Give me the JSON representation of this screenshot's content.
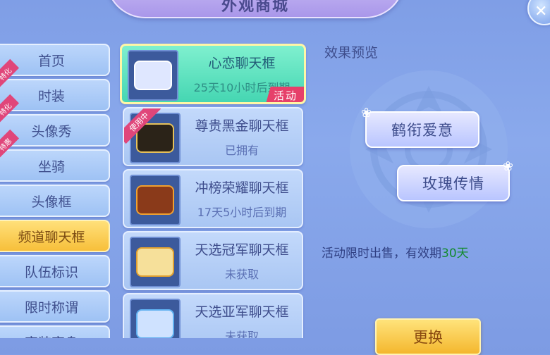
{
  "header": {
    "title": "外观商城"
  },
  "sidebar": {
    "items": [
      {
        "label": "首页"
      },
      {
        "label": "时装",
        "ribbon": "特化"
      },
      {
        "label": "头像秀",
        "ribbon": "特化"
      },
      {
        "label": "坐骑",
        "ribbon": "特惠"
      },
      {
        "label": "头像框"
      },
      {
        "label": "频道聊天框",
        "active": true
      },
      {
        "label": "队伍标识"
      },
      {
        "label": "限时称谓"
      },
      {
        "label": "变装变身"
      }
    ]
  },
  "items": [
    {
      "name": "心恋聊天框",
      "status": "25天10小时后到期",
      "badge": "活动",
      "bubble_color": "#dfe7ff",
      "selected": true
    },
    {
      "name": "尊贵黑金聊天框",
      "status": "已拥有",
      "badge": "使用中",
      "bubble_color": "#2b2318"
    },
    {
      "name": "冲榜荣耀聊天框",
      "status": "17天5小时后到期",
      "bubble_color": "#8a3a1a"
    },
    {
      "name": "天选冠军聊天框",
      "status": "未获取",
      "bubble_color": "#f6e09a"
    },
    {
      "name": "天选亚军聊天框",
      "status": "未获取",
      "bubble_color": "#cfe2ff"
    }
  ],
  "preview": {
    "title": "效果预览",
    "bubble1": "鹤衔爱意",
    "bubble2": "玫瑰传情"
  },
  "description": {
    "text": "活动限时出售，有效期",
    "highlight": "30天",
    "highlight_color": "#138a2e"
  },
  "exchange_button": {
    "label": "更换"
  }
}
